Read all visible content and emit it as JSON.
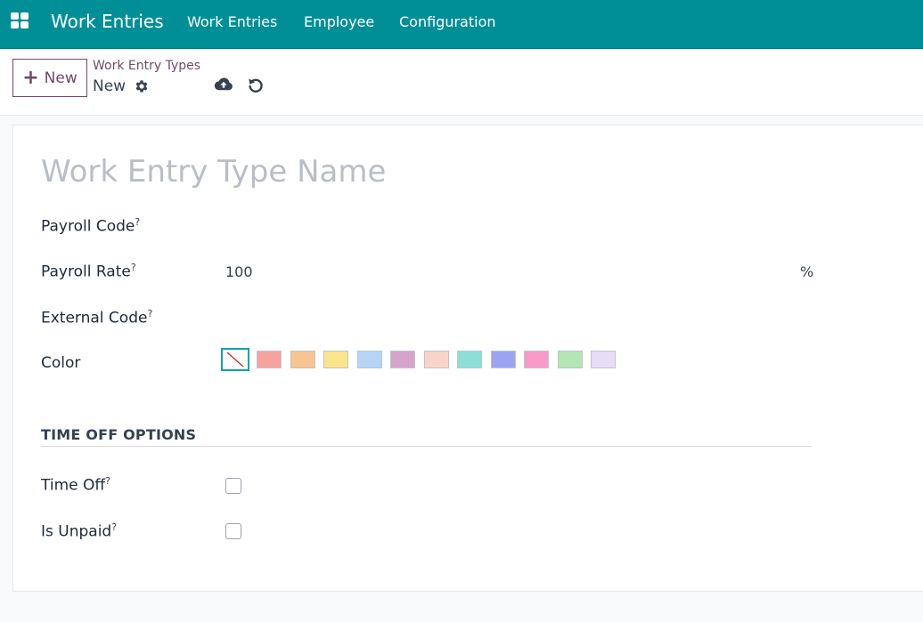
{
  "navbar": {
    "app_title": "Work Entries",
    "menu": [
      "Work Entries",
      "Employee",
      "Configuration"
    ]
  },
  "control_panel": {
    "new_button": "New",
    "breadcrumb_parent": "Work Entry Types",
    "breadcrumb_current": "New"
  },
  "form": {
    "name_placeholder": "Work Entry Type Name",
    "fields": {
      "payroll_code": {
        "label": "Payroll Code",
        "help": "?"
      },
      "payroll_rate": {
        "label": "Payroll Rate",
        "help": "?",
        "value": "100",
        "unit": "%"
      },
      "external_code": {
        "label": "External Code",
        "help": "?"
      },
      "color": {
        "label": "Color"
      }
    },
    "colors": [
      "none",
      "#f8a2a0",
      "#f9c491",
      "#fce48a",
      "#b6d5f6",
      "#d6a3ca",
      "#f9d3c6",
      "#8bdfd7",
      "#9ba3f4",
      "#f99ac9",
      "#b3e6b3",
      "#e8dcf9"
    ],
    "time_off_section": {
      "title": "TIME OFF OPTIONS",
      "time_off": {
        "label": "Time Off",
        "help": "?"
      },
      "is_unpaid": {
        "label": "Is Unpaid",
        "help": "?"
      }
    }
  },
  "icons": {
    "apps": "apps-grid-icon",
    "gear": "gear-icon",
    "save": "cloud-upload-icon",
    "discard": "undo-icon"
  },
  "accent": {
    "navbar": "#018f97",
    "primary": "#714b67"
  }
}
